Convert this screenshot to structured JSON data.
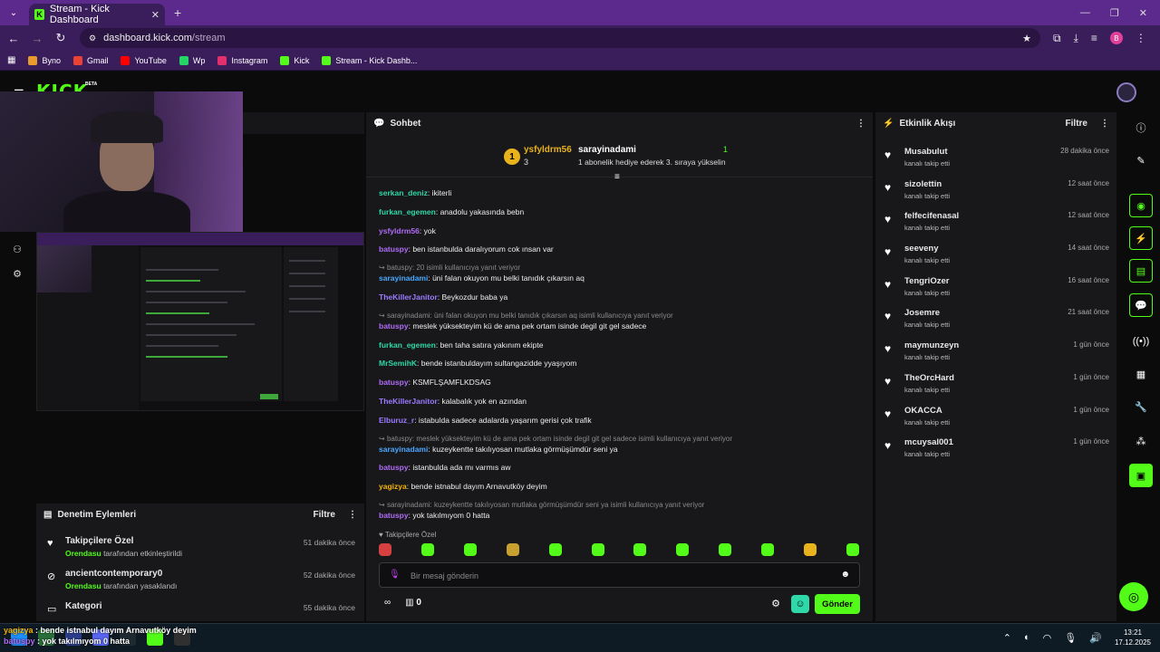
{
  "browser": {
    "tab_title": "Stream - Kick Dashboard",
    "url_host": "dashboard.kick.com",
    "url_path": "/stream",
    "profile_initial": "B",
    "bookmarks": [
      {
        "label": "Byno",
        "color": "#e89a2c"
      },
      {
        "label": "Gmail",
        "color": "#ea4335"
      },
      {
        "label": "YouTube",
        "color": "#ff0000"
      },
      {
        "label": "Wp",
        "color": "#25d366"
      },
      {
        "label": "Instagram",
        "color": "#e1306c"
      },
      {
        "label": "Kick",
        "color": "#53fc18"
      },
      {
        "label": "Stream - Kick Dashb...",
        "color": "#53fc18"
      }
    ]
  },
  "kick": {
    "logo": "KICK",
    "beta": "BETA"
  },
  "moderation": {
    "title": "Denetim Eylemleri",
    "filter": "Filtre",
    "items": [
      {
        "icon": "heart-icon",
        "title": "Takipçilere Özel",
        "by": "Orendasu",
        "action": "tarafından etkinleştirildi",
        "time": "51 dakika önce"
      },
      {
        "icon": "ban-icon",
        "title": "ancientcontemporary0",
        "by": "Orendasu",
        "action": "tarafından yasaklandı",
        "time": "52 dakika önce"
      },
      {
        "icon": "category-icon",
        "title": "Kategori",
        "by": "",
        "action": "",
        "time": "55 dakika önce"
      }
    ]
  },
  "chat": {
    "title": "Sohbet",
    "pinned": {
      "badge": "1",
      "gifter": "ysfyldrm56",
      "gifter_count": "3",
      "recipient": "sarayinadami",
      "description": "1 abonelik hediye ederek 3. sıraya yükselin",
      "right_count": "1"
    },
    "messages": [
      {
        "reply": "",
        "user": "serkan_deniz",
        "color": "#2fd8a8",
        "text": ": ikiterli"
      },
      {
        "reply": "",
        "user": "furkan_egemen",
        "color": "#2fd8a8",
        "text": ": anadolu yakasında bebn"
      },
      {
        "reply": "",
        "user": "ysfyldrm56",
        "color": "#b06cf5",
        "text": ": yok"
      },
      {
        "reply": "",
        "user": "batuspy",
        "color": "#b06cf5",
        "text": ": ben istanbulda daralıyorum cok ınsan var"
      },
      {
        "reply": "batuspy: 20 isimli kullanıcıya yanıt veriyor",
        "user": "sarayinadami",
        "color": "#4aa8ff",
        "text": ": üni falan okuyon mu belki tanıdık çıkarsın aq"
      },
      {
        "reply": "",
        "user": "TheKillerJanitor",
        "color": "#9b7bff",
        "text": ": Beykozdur baba ya"
      },
      {
        "reply": "sarayinadami: üni falan okuyon mu belki tanıdık çıkarsın aq isimli kullanıcıya yanıt veriyor",
        "user": "batuspy",
        "color": "#b06cf5",
        "text": ": meslek yüksekteyim kü de ama pek ortam isinde degil git gel sadece"
      },
      {
        "reply": "",
        "user": "furkan_egemen",
        "color": "#2fd8a8",
        "text": ": ben taha satıra yakınım ekipte"
      },
      {
        "reply": "",
        "user": "MrSemihK",
        "color": "#2fd8a8",
        "text": ": bende istanbuldayım sultangazidde yyaşıyom"
      },
      {
        "reply": "",
        "user": "batuspy",
        "color": "#b06cf5",
        "text": ": KSMFLŞAMFLKDSAG"
      },
      {
        "reply": "",
        "user": "TheKillerJanitor",
        "color": "#9b7bff",
        "text": ": kalabalık yok en azından"
      },
      {
        "reply": "",
        "user": "Elburuz_r",
        "color": "#9b7bff",
        "text": ": istabulda sadece adalarda yaşarım gerisi çok trafik"
      },
      {
        "reply": "batuspy: meslek yüksekteyim kü de ama pek ortam isinde degil git gel sadece isimli kullanıcıya yanıt veriyor",
        "user": "sarayinadami",
        "color": "#4aa8ff",
        "text": ": kuzeykentte takılıyosan mutlaka görmüşümdür seni ya"
      },
      {
        "reply": "",
        "user": "batuspy",
        "color": "#b06cf5",
        "text": ": istanbulda ada mı varmıs aw"
      },
      {
        "reply": "",
        "user": "yagizya",
        "color": "#f5b400",
        "text": ": bende istnabul dayım Arnavutköy deyim"
      },
      {
        "reply": "sarayinadami: kuzeykentte takılıyosan mutlaka görmüşümdür seni ya isimli kullanıcıya yanıt veriyor",
        "user": "batuspy",
        "color": "#b06cf5",
        "text": ": yok takılmıyom 0 hatta"
      }
    ],
    "followers_only": "Takipçilere Özel",
    "placeholder": "Bir mesaj gönderin",
    "points": "0",
    "send": "Gönder"
  },
  "activity": {
    "title": "Etkinlik Akışı",
    "filter": "Filtre",
    "items": [
      {
        "name": "Musabulut",
        "sub": "kanalı takip etti",
        "time": "28 dakika önce"
      },
      {
        "name": "sizolettin",
        "sub": "kanalı takip etti",
        "time": "12 saat önce"
      },
      {
        "name": "felfecifenasal",
        "sub": "kanalı takip etti",
        "time": "12 saat önce"
      },
      {
        "name": "seeveny",
        "sub": "kanalı takip etti",
        "time": "14 saat önce"
      },
      {
        "name": "TengriOzer",
        "sub": "kanalı takip etti",
        "time": "16 saat önce"
      },
      {
        "name": "Josemre",
        "sub": "kanalı takip etti",
        "time": "21 saat önce"
      },
      {
        "name": "maymunzeyn",
        "sub": "kanalı takip etti",
        "time": "1 gün önce"
      },
      {
        "name": "TheOrcHard",
        "sub": "kanalı takip etti",
        "time": "1 gün önce"
      },
      {
        "name": "OKACCA",
        "sub": "kanalı takip etti",
        "time": "1 gün önce"
      },
      {
        "name": "mcuysal001",
        "sub": "kanalı takip etti",
        "time": "1 gün önce"
      }
    ]
  },
  "overlay": {
    "line1_user": "yagizya",
    "line1_text": " : bende istnabul dayım Arnavutköy deyim",
    "line2_user": "batuspy",
    "line2_text": " : yok takılmıyom 0 hatta"
  },
  "taskbar": {
    "time": "13:21",
    "date": "17.12.2025"
  }
}
